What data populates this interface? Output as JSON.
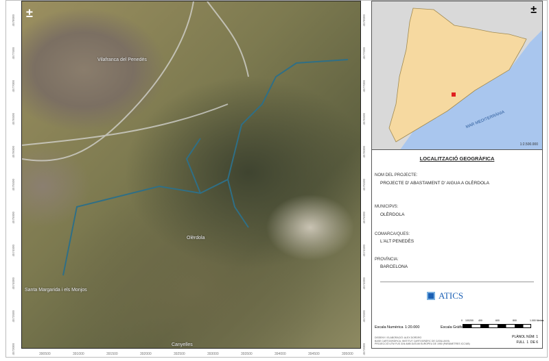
{
  "map": {
    "places": [
      "Vilafranca del Penedès",
      "Olèrdola",
      "Santa Margarida i els Monjos",
      "Canyelles"
    ],
    "x_ticks": [
      "390500",
      "391000",
      "391500",
      "392000",
      "392500",
      "393000",
      "393500",
      "394000",
      "394500",
      "395000"
    ],
    "y_ticks": [
      "4578000",
      "4577500",
      "4577000",
      "4576500",
      "4576000",
      "4575500",
      "4575000",
      "4574500",
      "4574000",
      "4573500",
      "4573000"
    ],
    "north_arrow": "north-arrow-icon",
    "route_color": "#2f6f86"
  },
  "inset": {
    "sea_label": "MAR MEDITERRÀNIA",
    "scale": "1:2.500.000",
    "land_color": "#f6d9a0",
    "sea_color": "#a9c6ee",
    "marker_color": "#e02020"
  },
  "info": {
    "title": "LOCALITZACIÓ GEOGRÀFICA",
    "project_label": "NOM DEL PROJECTE:",
    "project_value": "PROJECTE D' ABASTAMENT D' AIGUA A OLÈRDOLA",
    "municipality_label": "MUNICIPI/S:",
    "municipality_value": "OLÈRDOLA",
    "county_label": "COMARCA/QUES:",
    "county_value": "L'ALT PENEDÈS",
    "province_label": "PROVÍNCIA:",
    "province_value": "BARCELONA",
    "logo_text": "ATICS",
    "numeric_scale_label": "Escala Numèrica",
    "numeric_scale_value": "1:20.000",
    "graphic_scale_label": "Escala Gràfica",
    "graphic_scale_ticks": [
      "0",
      "100",
      "200",
      "400",
      "600",
      "800",
      "1.000 Metres"
    ],
    "credits": [
      "DISSENY I ELABORACIÓ: ALEX DORDRO",
      "BASE CARTOGRÀFICA: INSTITUT CARTOGRÀFIC DE CATALUNYA",
      "PROJECCIÓ UTM FUS 31N AMB DATUM EUROPEU DE 1950 (PARÀMETRES ICC/UB)"
    ],
    "plan_number": "PLÀNOL NÚM: 1",
    "sheet": "FULL  1  DE 6"
  }
}
